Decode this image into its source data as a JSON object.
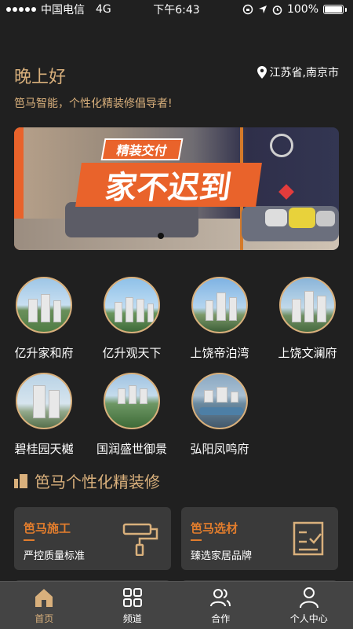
{
  "status_bar": {
    "carrier": "中国电信",
    "network": "4G",
    "time": "下午6:43",
    "battery": "100%"
  },
  "header": {
    "greeting": "晚上好",
    "location": "江苏省,南京市",
    "tagline": "笆马智能，个性化精装修倡导者!"
  },
  "banner": {
    "tag": "精装交付",
    "headline": "家不迟到"
  },
  "projects": [
    {
      "name": "亿升家和府"
    },
    {
      "name": "亿升观天下"
    },
    {
      "name": "上饶帝泊湾"
    },
    {
      "name": "上饶文澜府"
    },
    {
      "name": "碧桂园天樾"
    },
    {
      "name": "国润盛世御景"
    },
    {
      "name": "弘阳凤鸣府"
    }
  ],
  "section": {
    "title": "笆马个性化精装修"
  },
  "cards": [
    {
      "title": "笆马施工",
      "desc": "严控质量标准",
      "icon": "paint-roller-icon"
    },
    {
      "title": "笆马选材",
      "desc": "臻选家居品牌",
      "icon": "checklist-icon"
    }
  ],
  "tabbar": {
    "tabs": [
      {
        "label": "首页",
        "icon": "home-icon",
        "active": true
      },
      {
        "label": "频道",
        "icon": "grid-icon",
        "active": false
      },
      {
        "label": "合作",
        "icon": "users-icon",
        "active": false
      },
      {
        "label": "个人中心",
        "icon": "person-icon",
        "active": false
      }
    ]
  },
  "colors": {
    "accent_gold": "#d9b07c",
    "accent_orange": "#e27d2d",
    "background": "#202020",
    "card": "#3a3a3a",
    "tabbar": "#444444"
  }
}
